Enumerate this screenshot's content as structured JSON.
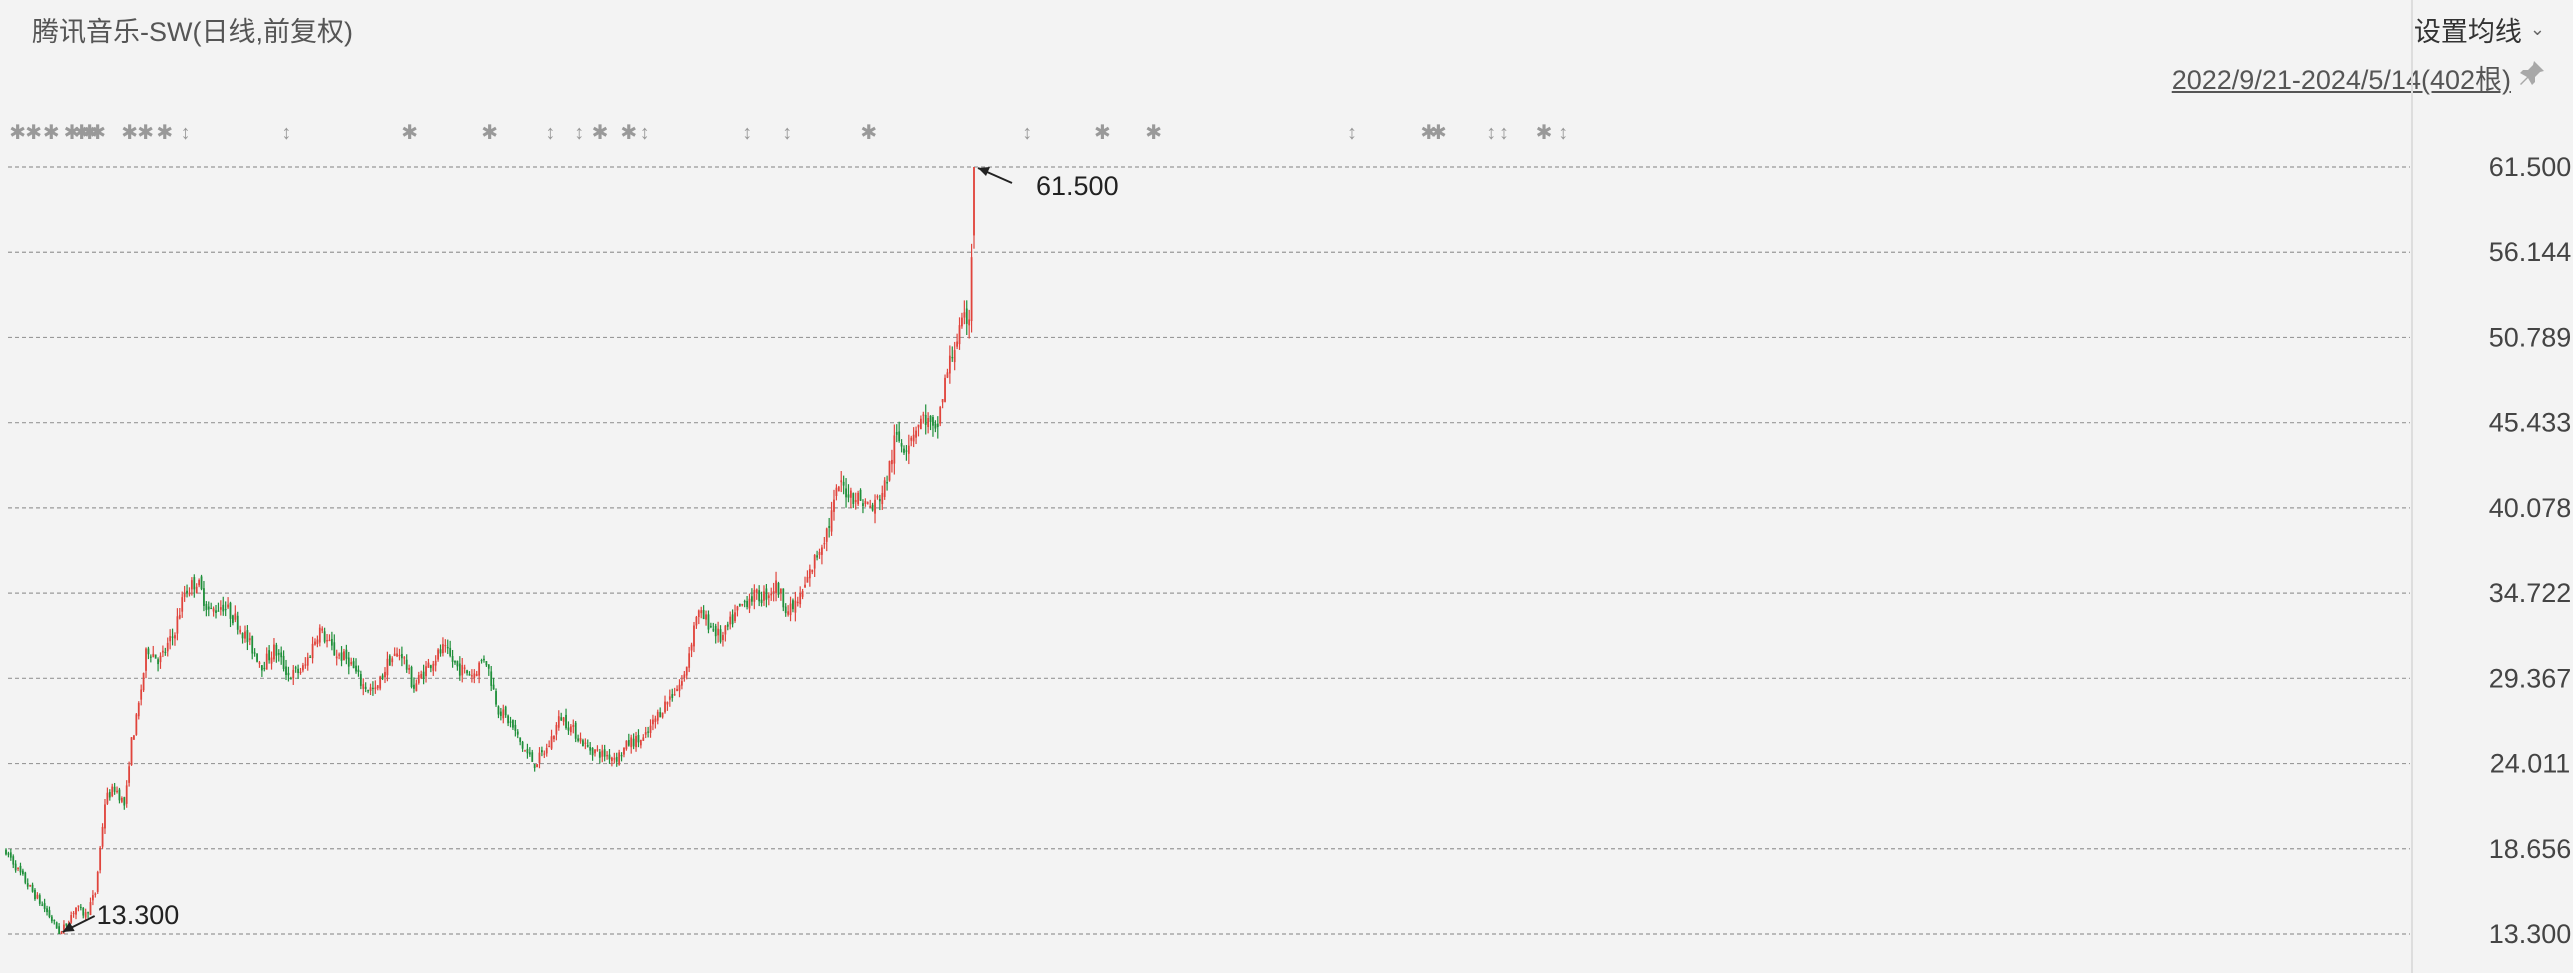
{
  "header": {
    "title": "腾讯音乐-SW(日线,前复权)",
    "ma_button": "设置均线",
    "range_label": "2022/9/21-2024/5/14(402根)"
  },
  "icons": {
    "ma_chevron": "chevron-down-icon",
    "pin": "pin-icon"
  },
  "colors": {
    "up": "#e0443c",
    "down": "#1f8f3a",
    "grid": "#999999",
    "background": "#f3f3f3"
  },
  "chart_data": {
    "type": "candlestick",
    "title": "腾讯音乐-SW(日线,前复权)",
    "x_start": "2022/9/21",
    "x_end": "2024/5/14",
    "bar_count": 402,
    "y_ticks": [
      "61.500",
      "56.144",
      "50.789",
      "45.433",
      "40.078",
      "34.722",
      "29.367",
      "24.011",
      "18.656",
      "13.300"
    ],
    "ylim": [
      13.3,
      61.5
    ],
    "grid": true,
    "annotations": {
      "max_label": "61.500",
      "min_label": "13.300"
    },
    "close_path": [
      [
        0,
        18.6
      ],
      [
        12,
        17.3
      ],
      [
        25,
        16.1
      ],
      [
        40,
        14.8
      ],
      [
        55,
        13.3
      ],
      [
        70,
        15.0
      ],
      [
        80,
        14.5
      ],
      [
        90,
        15.9
      ],
      [
        100,
        21.8
      ],
      [
        110,
        22.5
      ],
      [
        120,
        21.3
      ],
      [
        125,
        25.0
      ],
      [
        132,
        27.0
      ],
      [
        142,
        31.3
      ],
      [
        155,
        30.5
      ],
      [
        168,
        32.0
      ],
      [
        180,
        34.8
      ],
      [
        192,
        35.5
      ],
      [
        205,
        33.5
      ],
      [
        218,
        34.0
      ],
      [
        232,
        33.0
      ],
      [
        245,
        31.5
      ],
      [
        258,
        30.2
      ],
      [
        270,
        31.2
      ],
      [
        285,
        29.5
      ],
      [
        300,
        30.0
      ],
      [
        315,
        32.5
      ],
      [
        330,
        31.0
      ],
      [
        345,
        30.5
      ],
      [
        358,
        29.0
      ],
      [
        372,
        28.5
      ],
      [
        385,
        30.5
      ],
      [
        398,
        31.0
      ],
      [
        410,
        28.8
      ],
      [
        425,
        30.2
      ],
      [
        440,
        31.2
      ],
      [
        455,
        30.0
      ],
      [
        470,
        29.6
      ],
      [
        482,
        30.8
      ],
      [
        495,
        27.5
      ],
      [
        508,
        26.5
      ],
      [
        520,
        25.0
      ],
      [
        532,
        24.0
      ],
      [
        545,
        25.0
      ],
      [
        558,
        27.0
      ],
      [
        572,
        26.0
      ],
      [
        585,
        25.0
      ],
      [
        600,
        24.6
      ],
      [
        615,
        24.4
      ],
      [
        628,
        25.4
      ],
      [
        642,
        25.5
      ],
      [
        655,
        27.0
      ],
      [
        668,
        28.2
      ],
      [
        682,
        29.3
      ],
      [
        695,
        33.5
      ],
      [
        708,
        32.8
      ],
      [
        720,
        31.8
      ],
      [
        735,
        33.5
      ],
      [
        748,
        34.5
      ],
      [
        762,
        34.5
      ],
      [
        775,
        35.2
      ],
      [
        788,
        33.5
      ],
      [
        800,
        34.5
      ],
      [
        815,
        37.0
      ],
      [
        828,
        39.0
      ],
      [
        838,
        41.5
      ],
      [
        850,
        41.0
      ],
      [
        862,
        40.5
      ],
      [
        872,
        40.0
      ],
      [
        885,
        41.5
      ],
      [
        895,
        44.5
      ],
      [
        905,
        44.0
      ],
      [
        915,
        45.2
      ],
      [
        925,
        45.8
      ],
      [
        935,
        44.5
      ],
      [
        945,
        48.0
      ],
      [
        955,
        50.5
      ],
      [
        963,
        51.5
      ],
      [
        970,
        52.5
      ],
      [
        974,
        61.5
      ]
    ],
    "event_markers": [
      [
        "✱",
        6
      ],
      [
        "✱",
        16
      ],
      [
        "✱",
        27
      ],
      [
        "✱",
        40
      ],
      [
        "✱",
        46
      ],
      [
        "✱",
        51
      ],
      [
        "✱",
        56
      ],
      [
        "✱",
        76
      ],
      [
        "✱",
        86
      ],
      [
        "✱",
        98
      ],
      [
        "↕",
        111
      ],
      [
        "↕",
        174
      ],
      [
        "✱",
        251
      ],
      [
        "✱",
        301
      ],
      [
        "↕",
        339
      ],
      [
        "↕",
        357
      ],
      [
        "✱",
        370
      ],
      [
        "✱",
        388
      ],
      [
        "↕",
        398
      ],
      [
        "↕",
        462
      ],
      [
        "↕",
        487
      ],
      [
        "✱",
        538
      ],
      [
        "↕",
        637
      ],
      [
        "✱",
        684
      ],
      [
        "✱",
        716
      ],
      [
        "↕",
        840
      ],
      [
        "✱",
        888
      ],
      [
        "✱",
        894
      ],
      [
        "↕",
        927
      ],
      [
        "↕",
        935
      ],
      [
        "✱",
        960
      ],
      [
        "↕",
        972
      ]
    ]
  }
}
